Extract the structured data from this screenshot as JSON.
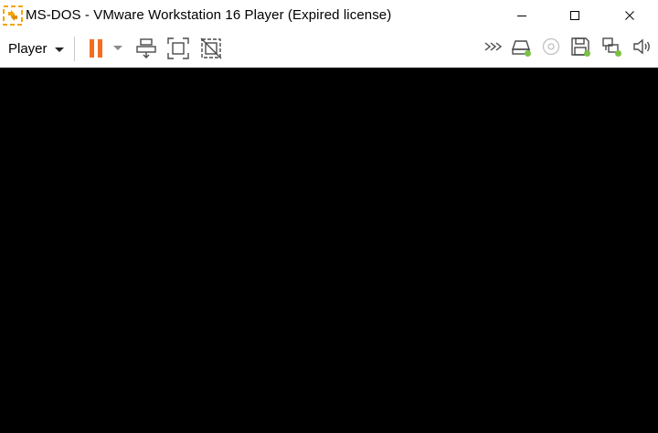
{
  "window": {
    "title": "MS-DOS - VMware Workstation 16 Player (Expired license)",
    "app_icon": "vmware-logo-icon",
    "controls": [
      "minimize-icon",
      "maximize-icon",
      "close-icon"
    ]
  },
  "toolbar": {
    "player_menu_label": "Player",
    "buttons": [
      "pause-icon",
      "send-ctrl-alt-del-icon",
      "fullscreen-icon",
      "unity-icon"
    ],
    "devices": [
      "more-devices-icon",
      "hard-disk-icon",
      "cd-dvd-icon",
      "floppy-icon",
      "network-adapter-icon",
      "sound-icon"
    ]
  },
  "colors": {
    "pause_accent": "#f36d21",
    "device_active": "#7ac143",
    "logo_accent": "#f5a400",
    "vm_screen": "#000000"
  }
}
